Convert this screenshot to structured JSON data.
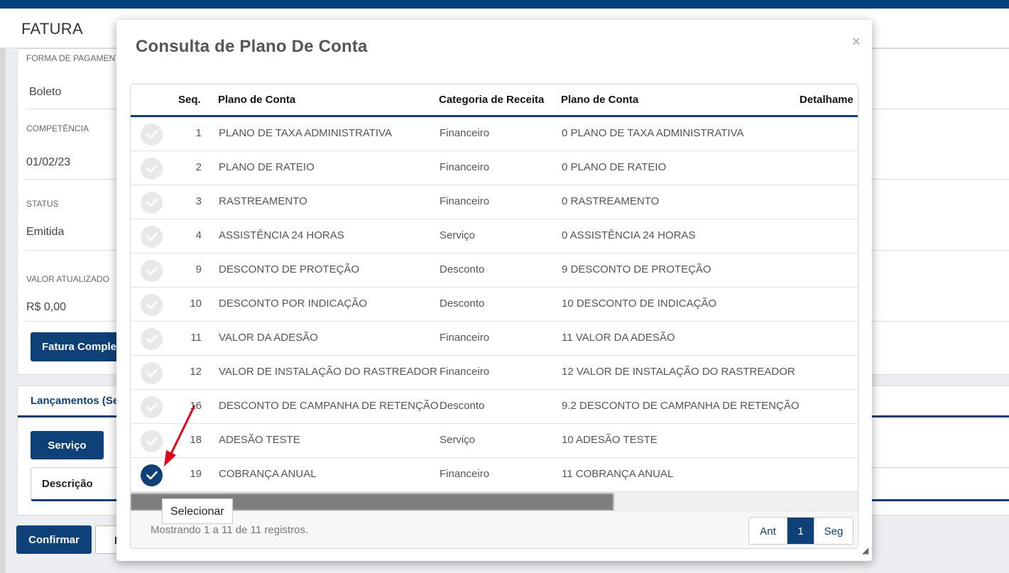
{
  "page": {
    "title": "FATURA",
    "fields": [
      {
        "label": "FORMA DE PAGAMENTO",
        "value": "Boleto"
      },
      {
        "label": "COMPETÊNCIA",
        "value": "01/02/23"
      },
      {
        "label": "STATUS",
        "value": "Emitida"
      },
      {
        "label": "VALOR ATUALIZADO",
        "value": "R$ 0,00"
      }
    ],
    "fatura_button": "Fatura Comple",
    "lancamentos_title": "Lançamentos (Se",
    "servico_button": "Serviço",
    "descricao_label": "Descrição",
    "confirmar_button": "Confirmar",
    "outline_button": "I"
  },
  "modal": {
    "title": "Consulta de Plano De Conta",
    "close": "×",
    "columns": [
      "Seq.",
      "Plano de Conta",
      "Categoria de Receita",
      "Plano de Conta",
      "Detalhame"
    ],
    "rows": [
      {
        "seq": "1",
        "plano": "PLANO DE TAXA ADMINISTRATIVA",
        "categoria": "Financeiro",
        "plano2": "0 PLANO DE TAXA ADMINISTRATIVA",
        "selected": false
      },
      {
        "seq": "2",
        "plano": "PLANO DE RATEIO",
        "categoria": "Financeiro",
        "plano2": "0 PLANO DE RATEIO",
        "selected": false
      },
      {
        "seq": "3",
        "plano": "RASTREAMENTO",
        "categoria": "Financeiro",
        "plano2": "0 RASTREAMENTO",
        "selected": false
      },
      {
        "seq": "4",
        "plano": "ASSISTÊNCIA 24 HORAS",
        "categoria": "Serviço",
        "plano2": "0 ASSISTÊNCIA 24 HORAS",
        "selected": false
      },
      {
        "seq": "9",
        "plano": "DESCONTO DE PROTEÇÃO",
        "categoria": "Desconto",
        "plano2": "9 DESCONTO DE PROTEÇÃO",
        "selected": false
      },
      {
        "seq": "10",
        "plano": "DESCONTO POR INDICAÇÃO",
        "categoria": "Desconto",
        "plano2": "10 DESCONTO DE INDICAÇÃO",
        "selected": false
      },
      {
        "seq": "11",
        "plano": "VALOR DA ADESÃO",
        "categoria": "Financeiro",
        "plano2": "11 VALOR DA ADESÃO",
        "selected": false
      },
      {
        "seq": "12",
        "plano": "VALOR DE INSTALAÇÃO DO RASTREADOR",
        "categoria": "Financeiro",
        "plano2": "12 VALOR DE INSTALAÇÃO DO RASTREADOR",
        "selected": false
      },
      {
        "seq": "16",
        "plano": "DESCONTO DE CAMPANHA DE RETENÇÃO",
        "categoria": "Desconto",
        "plano2": "9.2 DESCONTO DE CAMPANHA DE RETENÇÃO",
        "selected": false
      },
      {
        "seq": "18",
        "plano": "ADESÃO TESTE",
        "categoria": "Serviço",
        "plano2": "10 ADESÃO TESTE",
        "selected": false
      },
      {
        "seq": "19",
        "plano": "COBRANÇA ANUAL",
        "categoria": "Financeiro",
        "plano2": "11 COBRANÇA ANUAL",
        "selected": true
      }
    ],
    "footer_info": "Mostrando 1 a 11 de 11 registros.",
    "pager": {
      "prev": "Ant",
      "current": "1",
      "next": "Seg"
    },
    "tooltip": "Selecionar"
  },
  "colors": {
    "primary": "#0e4178",
    "annotation_arrow": "#e3001b"
  },
  "icons": {
    "check": "check-icon",
    "close": "close-icon"
  }
}
